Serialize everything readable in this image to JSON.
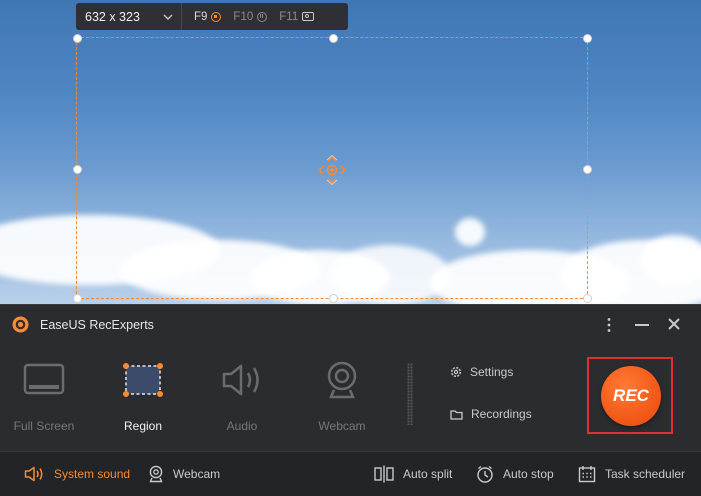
{
  "toolbar": {
    "size": "632 x 323",
    "keys": [
      {
        "label": "F9",
        "icon": "stop-record-icon"
      },
      {
        "label": "F10",
        "icon": "pause-icon"
      },
      {
        "label": "F11",
        "icon": "screenshot-icon"
      }
    ]
  },
  "app": {
    "title": "EaseUS RecExperts",
    "accent": "#ff8a2b",
    "rec_color": "#f35a1a"
  },
  "modes": [
    {
      "label": "Full Screen",
      "icon": "monitor-icon",
      "active": false
    },
    {
      "label": "Region",
      "icon": "region-select-icon",
      "active": true
    },
    {
      "label": "Audio",
      "icon": "speaker-icon",
      "active": false
    },
    {
      "label": "Webcam",
      "icon": "webcam-icon",
      "active": false
    }
  ],
  "side_links": {
    "settings": "Settings",
    "recordings": "Recordings"
  },
  "rec_label": "REC",
  "bottom": {
    "system_sound": "System sound",
    "webcam": "Webcam",
    "auto_split": "Auto split",
    "auto_stop": "Auto stop",
    "task_scheduler": "Task scheduler"
  }
}
